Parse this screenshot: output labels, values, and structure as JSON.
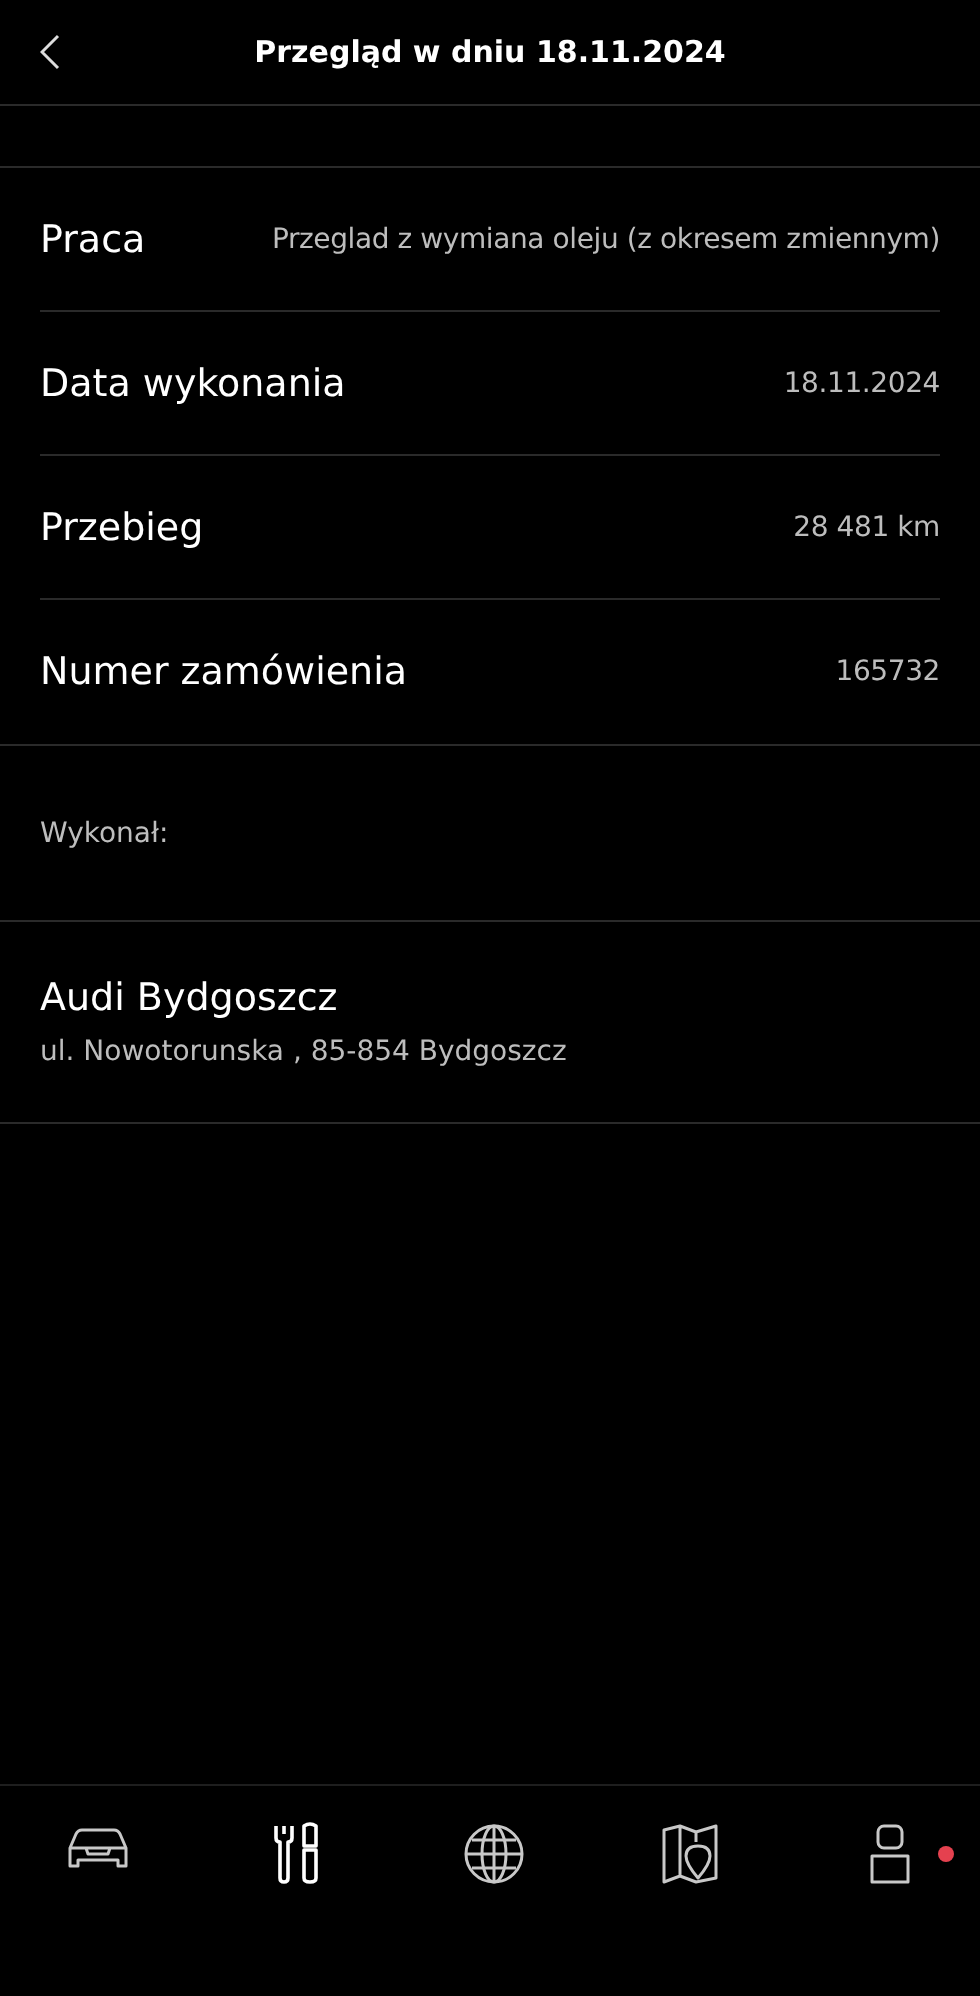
{
  "header": {
    "title": "Przegląd w dniu 18.11.2024"
  },
  "details": [
    {
      "label": "Praca",
      "value": "Przeglad z wymiana oleju (z okresem zmiennym)"
    },
    {
      "label": "Data wykonania",
      "value": "18.11.2024"
    },
    {
      "label": "Przebieg",
      "value": "28 481 km"
    },
    {
      "label": "Numer zamówienia",
      "value": "165732"
    }
  ],
  "performed_by": {
    "heading": "Wykonał:",
    "name": "Audi Bydgoszcz",
    "address": "ul. Nowotorunska , 85-854 Bydgoszcz"
  },
  "nav": [
    {
      "kind": "car",
      "selected": false,
      "badge": false
    },
    {
      "kind": "tools",
      "selected": true,
      "badge": false
    },
    {
      "kind": "globe",
      "selected": false,
      "badge": false
    },
    {
      "kind": "map",
      "selected": false,
      "badge": false
    },
    {
      "kind": "profile",
      "selected": false,
      "badge": true
    }
  ]
}
